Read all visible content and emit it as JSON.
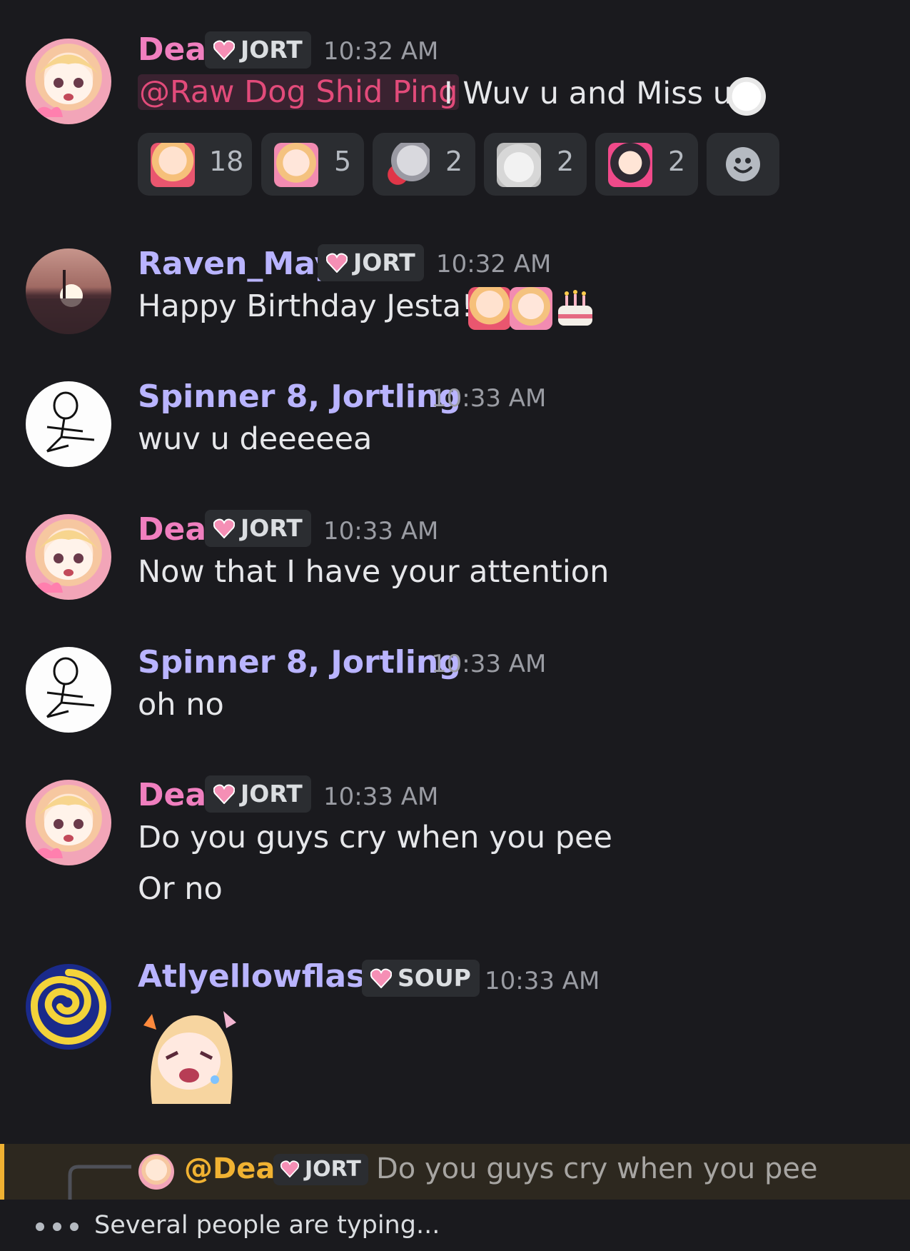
{
  "colors": {
    "background": "#1a1a1e",
    "dea_name": "#f07fbf",
    "member_name": "#b9b4ff",
    "mention": "#e24b7a",
    "reply_name": "#f0b232",
    "tag_bg": "#2b2d31",
    "heart": "#f58fb5"
  },
  "messages": [
    {
      "author": "Dea",
      "tag": "JORT",
      "time": "10:32 AM",
      "mention": "@Raw Dog Shid Ping",
      "text": " I Wuv u and Miss u",
      "reactions": [
        {
          "emoji": "anime-girl-heart-emoji",
          "count": "18"
        },
        {
          "emoji": "anime-girl-blush-emoji",
          "count": "5"
        },
        {
          "emoji": "bunny-heart-emoji",
          "count": "2"
        },
        {
          "emoji": "cat-emoji",
          "count": "2"
        },
        {
          "emoji": "dark-hair-girl-emoji",
          "count": "2"
        }
      ]
    },
    {
      "author": "Raven_May",
      "tag": "JORT",
      "time": "10:32 AM",
      "text": "Happy Birthday Jesta!!"
    },
    {
      "author": "Spinner 8, Jortling",
      "time": "10:33 AM",
      "text": "wuv u deeeeea"
    },
    {
      "author": "Dea",
      "tag": "JORT",
      "time": "10:33 AM",
      "text": "Now that I have your attention"
    },
    {
      "author": "Spinner 8, Jortling",
      "time": "10:33 AM",
      "text": "oh no"
    },
    {
      "author": "Dea",
      "tag": "JORT",
      "time": "10:33 AM",
      "text": "Do you guys cry when you pee",
      "text2": "Or no"
    },
    {
      "author": "Atlyellowflash",
      "tag": "SOUP",
      "time": "10:33 AM",
      "sticker": "anime-girl-crying-sticker"
    }
  ],
  "reply": {
    "author": "@Dea",
    "tag": "JORT",
    "text": "Do you guys cry when you pee"
  },
  "typing": {
    "text": "Several people are typing..."
  }
}
